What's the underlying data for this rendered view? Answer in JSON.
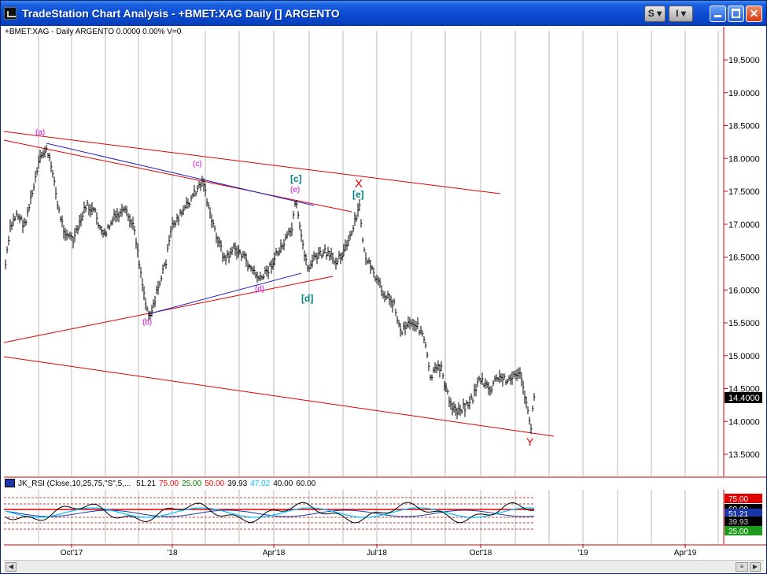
{
  "window": {
    "title": "TradeStation Chart Analysis - +BMET:XAG Daily [] ARGENTO",
    "btn_s": "S",
    "btn_i": "I"
  },
  "symbol_info": "+BMET:XAG - Daily  ARGENTO  0.0000  0.00%  V=0",
  "price_axis": {
    "labels": [
      "19.5000",
      "19.0000",
      "18.5000",
      "18.0000",
      "17.5000",
      "17.0000",
      "16.5000",
      "16.0000",
      "15.5000",
      "15.0000",
      "14.5000",
      "14.0000",
      "13.5000"
    ],
    "last_price": "14.4000"
  },
  "time_axis": {
    "labels": [
      "Oct'17",
      "'18",
      "Apr'18",
      "Jul'18",
      "Oct'18",
      "'19",
      "Apr'19"
    ]
  },
  "wave_labels": {
    "a": "(a)",
    "b": "(b)",
    "c": "(c)",
    "d": "(d)",
    "e": "(e)",
    "c_big": "[c]",
    "d_big": "[d]",
    "e_big": "[e]",
    "x": "X",
    "y": "Y"
  },
  "rsi": {
    "name": "JK_RSI (Close,10,25,75,\"S\",5,...",
    "values": [
      "51.21",
      "75.00",
      "25.00",
      "50.00",
      "39.93",
      "47.02",
      "40.00",
      "60.00"
    ],
    "value_colors": [
      "#000000",
      "#ff0000",
      "#008000",
      "#ff0000",
      "#000000",
      "#00c0ff",
      "#000000",
      "#000000"
    ],
    "axis_labels": [
      "75.00",
      "60.00",
      "51.21",
      "39.93",
      "25.00"
    ]
  },
  "colors": {
    "accent": "#0a4bd0",
    "grid": "#b8b8b8",
    "trendline": "#e00000",
    "blueline": "#2020c0",
    "price": "#000000"
  }
}
